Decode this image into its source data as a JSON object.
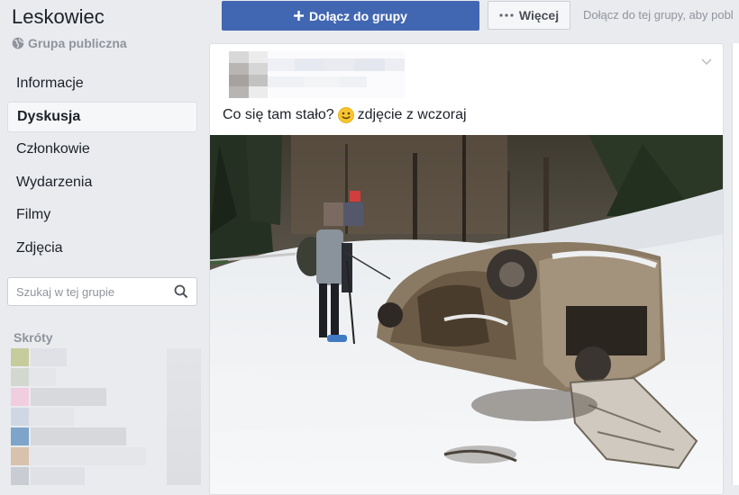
{
  "group": {
    "name": "Leskowiec",
    "privacy_label": "Grupa publiczna"
  },
  "nav": {
    "items": [
      {
        "label": "Informacje"
      },
      {
        "label": "Dyskusja",
        "active": true
      },
      {
        "label": "Członkowie"
      },
      {
        "label": "Wydarzenia"
      },
      {
        "label": "Filmy"
      },
      {
        "label": "Zdjęcia"
      }
    ]
  },
  "search": {
    "placeholder": "Szukaj w tej grupie",
    "icon": "search-icon"
  },
  "shortcuts": {
    "title": "Skróty"
  },
  "toolbar": {
    "join_label": "Dołącz do grupy",
    "join_icon": "plus-icon",
    "more_label": "Więcej",
    "more_icon": "ellipsis-icon",
    "join_hint": "Dołącz do tej grupy, aby pobl"
  },
  "post": {
    "text_before": "Co się tam stało?",
    "emoji": "smiley-icon",
    "text_after": "zdjęcie z wczoraj",
    "menu_icon": "chevron-down-icon"
  },
  "colors": {
    "accent": "#4267b2",
    "background": "#e9ebee",
    "text": "#1d2129",
    "muted": "#90949c"
  }
}
